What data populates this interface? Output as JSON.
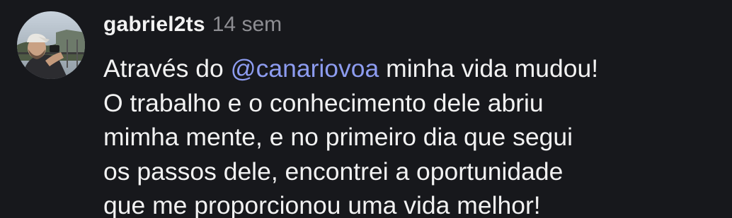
{
  "comment": {
    "username": "gabriel2ts",
    "time": "14 sem",
    "text": {
      "line1_before": "Através do ",
      "mention": "@canariovoa",
      "line1_after": " minha vida mudou!",
      "line2": "O trabalho e o conhecimento dele abriu",
      "line3": "mimha mente, e no primeiro dia que segui",
      "line4": "os passos dele, encontrei a oportunidade",
      "line5": "que me proporcionou uma vida melhor!"
    },
    "avatar_icon": "user-avatar-photo"
  },
  "colors": {
    "background": "#17181c",
    "text": "#f2f2f2",
    "muted": "#8e8e93",
    "mention": "#8d9cf0"
  }
}
